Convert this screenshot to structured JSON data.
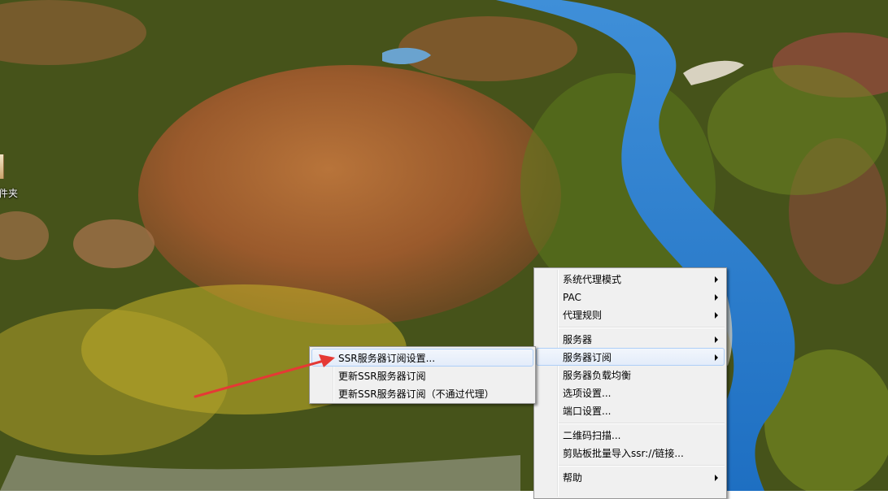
{
  "desktop": {
    "icon_label": "件夹"
  },
  "main_menu": {
    "items": [
      {
        "label": "系统代理模式",
        "has_submenu": true
      },
      {
        "label": "PAC",
        "has_submenu": true
      },
      {
        "label": "代理规则",
        "has_submenu": true
      },
      {
        "label": "服务器",
        "has_submenu": true
      },
      {
        "label": "服务器订阅",
        "has_submenu": true,
        "highlighted": true
      },
      {
        "label": "服务器负载均衡",
        "has_submenu": false
      },
      {
        "label": "选项设置...",
        "has_submenu": false
      },
      {
        "label": "端口设置...",
        "has_submenu": false
      },
      {
        "label": "二维码扫描...",
        "has_submenu": false
      },
      {
        "label": "剪贴板批量导入ssr://链接...",
        "has_submenu": false
      },
      {
        "label": "帮助",
        "has_submenu": true
      }
    ]
  },
  "sub_menu": {
    "items": [
      {
        "label": "SSR服务器订阅设置...",
        "highlighted": true
      },
      {
        "label": "更新SSR服务器订阅"
      },
      {
        "label": "更新SSR服务器订阅（不通过代理）"
      }
    ]
  },
  "annotation": {
    "color": "#e53935",
    "icon": "red-arrow"
  }
}
